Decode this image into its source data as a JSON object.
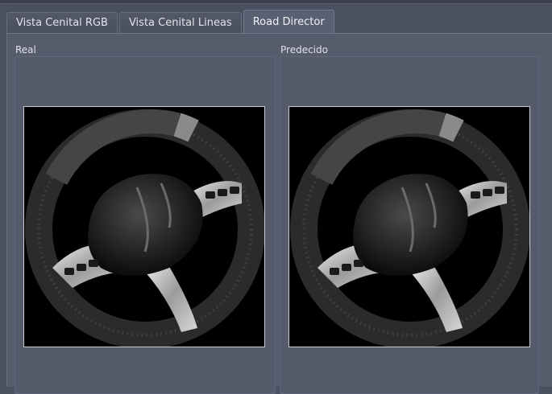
{
  "tabs": [
    {
      "label": "Vista Cenital RGB",
      "active": false
    },
    {
      "label": "Vista Cenital Lineas",
      "active": false
    },
    {
      "label": "Road Director",
      "active": true
    }
  ],
  "panels": {
    "left": {
      "label": "Real",
      "image": "steering-wheel-icon"
    },
    "right": {
      "label": "Predecido",
      "image": "steering-wheel-icon"
    }
  }
}
